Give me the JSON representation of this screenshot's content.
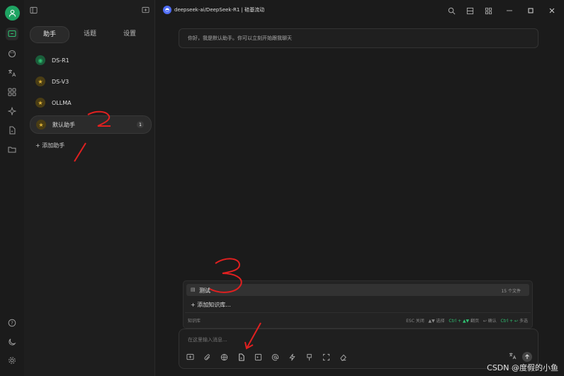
{
  "window": {
    "title": "deepseek-ai/DeepSeek-R1 | 硅基流动",
    "logo_glyph": "◓",
    "accent": "#2fbf71"
  },
  "rail": {
    "icons": [
      "user-icon",
      "chat-icon",
      "palette-icon",
      "translate-icon",
      "apps-icon",
      "sparkle-icon",
      "file-icon",
      "folder-icon",
      "help-icon",
      "moon-icon",
      "gear-icon"
    ]
  },
  "tabs": [
    {
      "label": "助手",
      "active": true
    },
    {
      "label": "话题",
      "active": false
    },
    {
      "label": "设置",
      "active": false
    }
  ],
  "assistants": [
    {
      "name": "DS-R1",
      "color": "#1b9e5a",
      "glyph": "◉"
    },
    {
      "name": "DS-V3",
      "color": "#7a6520",
      "glyph": "★"
    },
    {
      "name": "OLLMA",
      "color": "#7a6520",
      "glyph": "★"
    },
    {
      "name": "默认助手",
      "color": "#7a6520",
      "glyph": "★",
      "badge": "1",
      "selected": true
    }
  ],
  "add_assistant": "+ 添加助手",
  "greeting": "你好，我是默认助手。你可以立刻开始跟我聊天",
  "knowledge": {
    "item_label": "测试",
    "item_count": "15 个文件",
    "add_label": "+ 添加知识库...",
    "footer_label": "知识库",
    "hints": {
      "esc": "ESC 关闭",
      "select": "▲▼ 选择",
      "page_key": "Ctrl + ▲▼",
      "page": "翻页",
      "confirm": "↩ 确认",
      "multi_key": "Ctrl + ↩",
      "multi": "多选"
    }
  },
  "input": {
    "placeholder": "在这里输入消息..."
  },
  "watermark": "CSDN @度假的小鱼",
  "annotations": [
    "2",
    "3"
  ]
}
